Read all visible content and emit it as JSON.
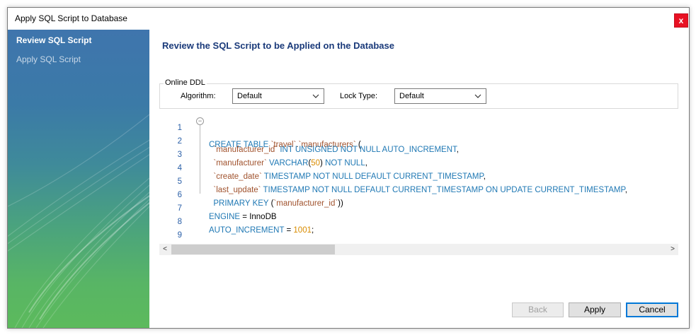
{
  "window": {
    "title": "Apply SQL Script to Database",
    "close_glyph": "x"
  },
  "sidebar": {
    "items": [
      {
        "label": "Review SQL Script",
        "active": true
      },
      {
        "label": "Apply SQL Script",
        "active": false
      }
    ]
  },
  "main": {
    "heading": "Review the SQL Script to be Applied on the Database",
    "online_ddl": {
      "legend": "Online DDL",
      "algorithm_label": "Algorithm:",
      "algorithm_value": "Default",
      "lock_type_label": "Lock Type:",
      "lock_type_value": "Default"
    },
    "editor": {
      "line_numbers": [
        "1",
        "2",
        "3",
        "4",
        "5",
        "6",
        "7",
        "8",
        "9"
      ],
      "fold_glyph": "−"
    },
    "scrollbar": {
      "left_arrow": "<",
      "right_arrow": ">"
    }
  },
  "buttons": {
    "back": "Back",
    "apply": "Apply",
    "cancel": "Cancel"
  },
  "colors": {
    "keyword": "#1f78b4",
    "identifier": "#a0522d",
    "number": "#d98c00",
    "heading": "#1a3a7a",
    "close": "#e81123"
  }
}
